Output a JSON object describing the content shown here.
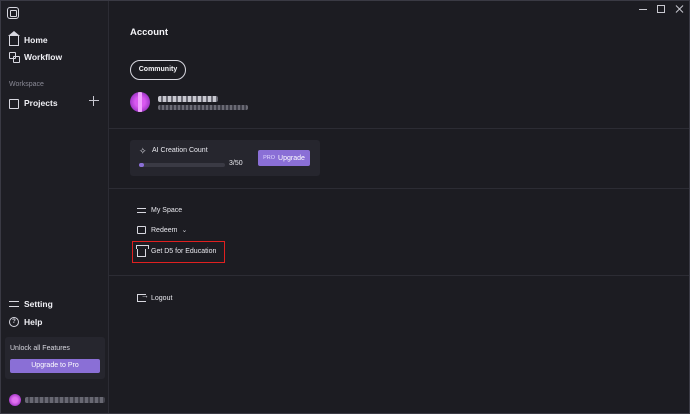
{
  "sidebar": {
    "nav": [
      {
        "label": "Home",
        "icon": "home-icon"
      },
      {
        "label": "Workflow",
        "icon": "workflow-icon"
      }
    ],
    "section_label": "Workspace",
    "projects_label": "Projects",
    "bottom": [
      {
        "label": "Setting",
        "icon": "settings-icon"
      },
      {
        "label": "Help",
        "icon": "help-icon"
      }
    ],
    "unlock_title": "Unlock all Features",
    "upgrade_label": "Upgrade to Pro"
  },
  "main": {
    "title": "Account",
    "community_label": "Community",
    "ai_card": {
      "title": "AI Creation Count",
      "used": 3,
      "limit": 50,
      "count_text": "3/50",
      "pro_tag": "PRO",
      "upgrade_label": "Upgrade"
    },
    "menu": {
      "my_space": "My Space",
      "redeem": "Redeem",
      "education": "Get D5 for Education",
      "logout": "Logout"
    }
  },
  "colors": {
    "accent": "#8a6fd6",
    "background": "#1c1c22",
    "highlight": "#e02020"
  }
}
